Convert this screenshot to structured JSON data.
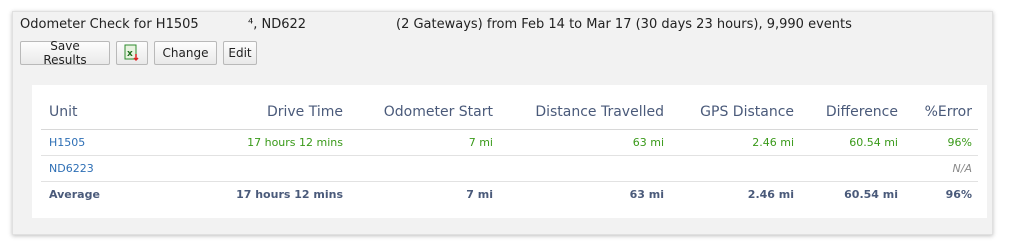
{
  "header": {
    "title_main": "Odometer Check for H1505",
    "title_units": "⁴, ND622",
    "title_summary": "(2 Gateways) from Feb 14 to Mar 17 (30 days 23 hours), 9,990 events"
  },
  "toolbar": {
    "save_results_label": "Save Results",
    "excel_icon": "excel-export-icon",
    "change_label": "Change",
    "edit_label": "Edit"
  },
  "table": {
    "columns": [
      "Unit",
      "Drive Time",
      "Odometer Start",
      "Distance Travelled",
      "GPS Distance",
      "Difference",
      "%Error"
    ],
    "rows": [
      {
        "unit": "H1505",
        "drive_time": "17 hours 12 mins",
        "odometer_start": "7 mi",
        "distance_travelled": "63 mi",
        "gps_distance": "2.46 mi",
        "difference": "60.54 mi",
        "error": "96%"
      },
      {
        "unit": "ND6223",
        "drive_time": "",
        "odometer_start": "",
        "distance_travelled": "",
        "gps_distance": "",
        "difference": "",
        "error": "N/A"
      }
    ],
    "average": {
      "unit": "Average",
      "drive_time": "17 hours 12 mins",
      "odometer_start": "7 mi",
      "distance_travelled": "63 mi",
      "gps_distance": "2.46 mi",
      "difference": "60.54 mi",
      "error": "96%"
    }
  },
  "colors": {
    "link": "#2e6fb5",
    "value_green": "#3a9a1a",
    "header_text": "#4a5a7a",
    "na_gray": "#8a8a8a"
  }
}
